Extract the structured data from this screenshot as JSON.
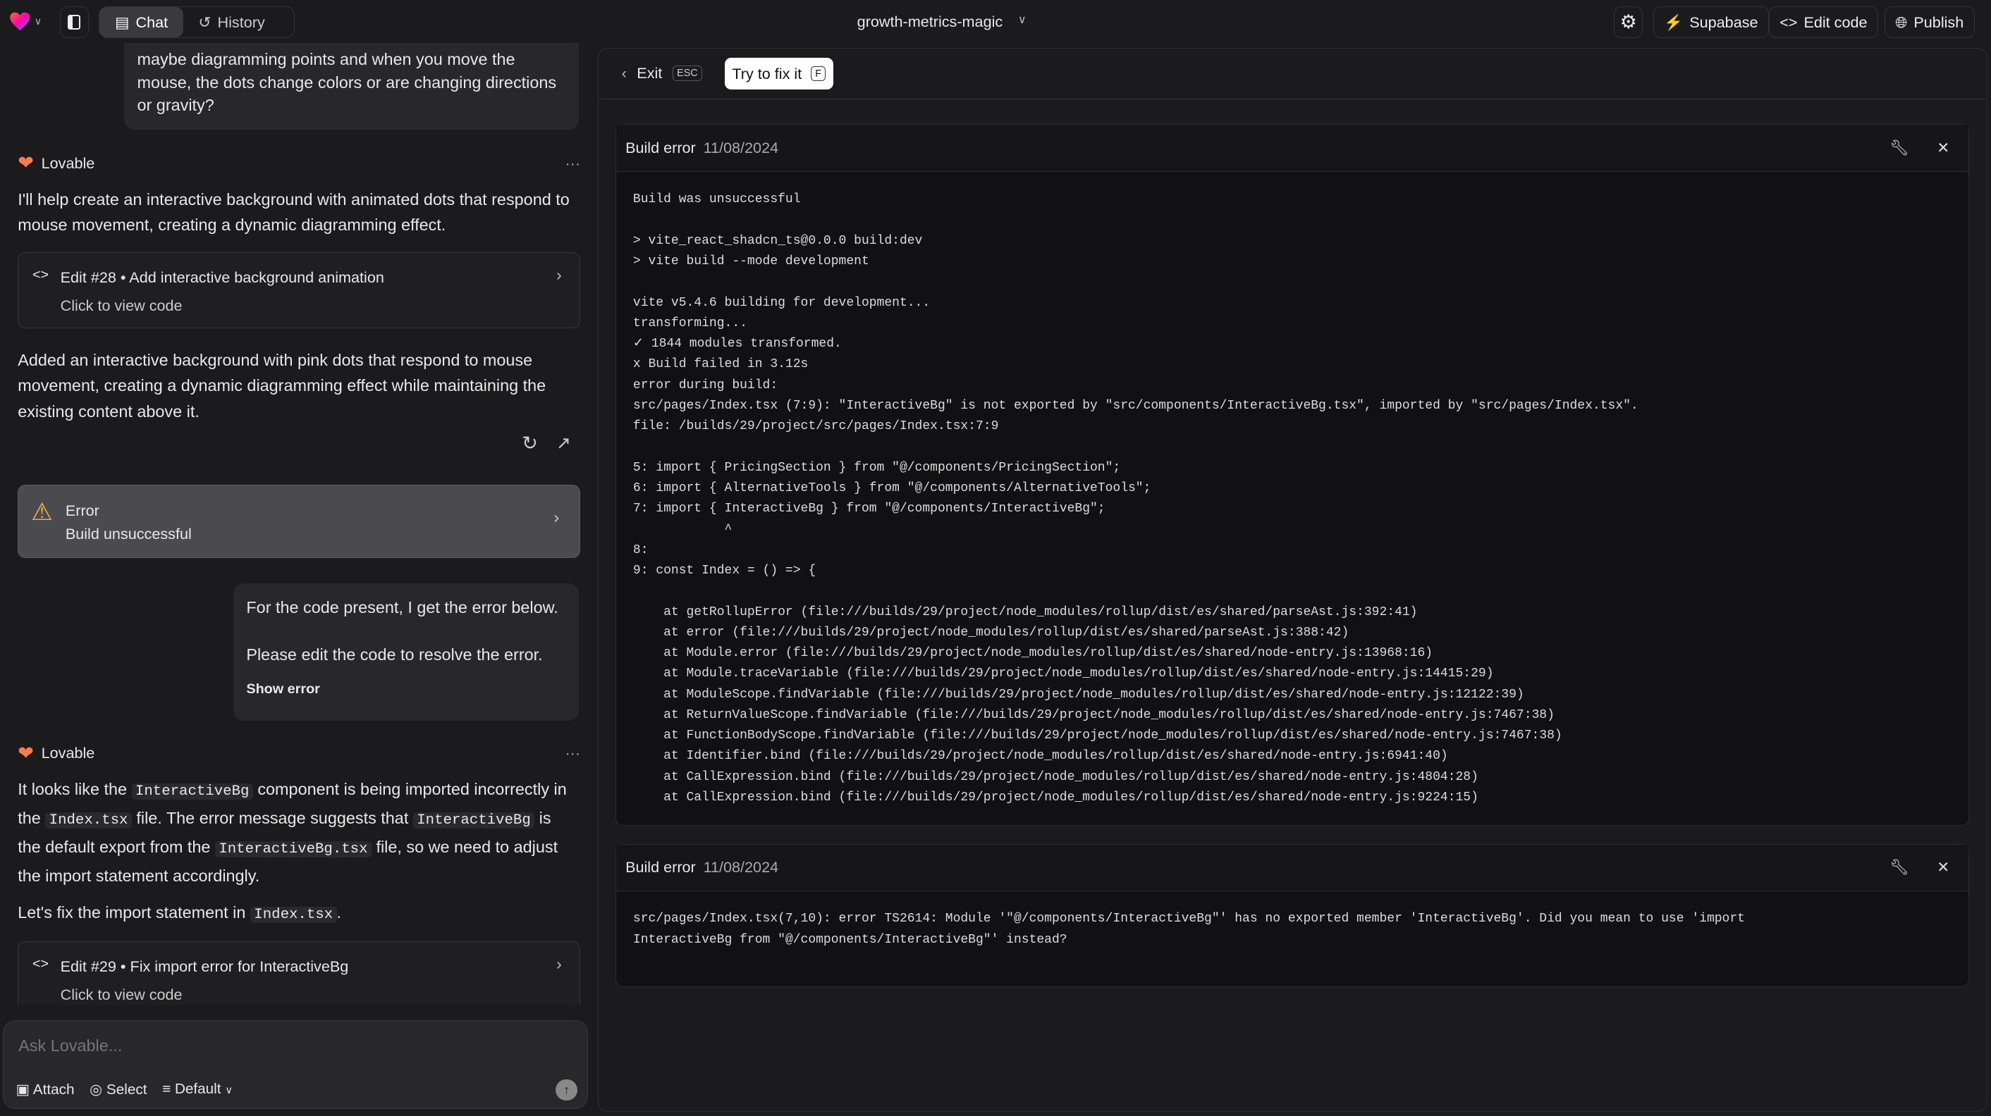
{
  "topbar": {
    "tabs": [
      {
        "label": "Chat",
        "icon": "chat-icon"
      },
      {
        "label": "History",
        "icon": "history-icon"
      }
    ],
    "project": "growth-metrics-magic",
    "buttons": {
      "supabase": "Supabase",
      "edit_code": "Edit code",
      "publish": "Publish"
    },
    "colors": {
      "supabase": "#3ecf8e"
    }
  },
  "chat": {
    "user_msg_1": "maybe diagramming points and when you move the mouse, the dots change colors or are changing directions or gravity?",
    "assistant_name": "Lovable",
    "reply_1": "I'll help create an interactive background with animated dots that respond to mouse movement, creating a dynamic diagramming effect.",
    "edit_28": {
      "title": "Edit #28 • Add interactive background animation",
      "sub": "Click to view code"
    },
    "reply_2": "Added an interactive background with pink dots that respond to mouse movement, creating a dynamic diagramming effect while maintaining the existing content above it.",
    "error_card": {
      "title": "Error",
      "sub": "Build unsuccessful"
    },
    "user_msg_2": {
      "line1": "For the code present, I get the error below.",
      "line2": "Please edit the code to resolve the error.",
      "link": "Show error"
    },
    "reply_3": {
      "a": "It looks like the ",
      "b": "InteractiveBg",
      "c": " component is being imported incorrectly in the ",
      "d": "Index.tsx",
      "e": " file. The error message suggests that ",
      "f": "InteractiveBg",
      "g": " is the default export from the ",
      "h": "InteractiveBg.tsx",
      "i": " file, so we need to adjust the import statement accordingly."
    },
    "reply_4": {
      "a": "Let's fix the import statement in ",
      "b": "Index.tsx",
      "c": "."
    },
    "edit_29": {
      "title": "Edit #29 • Fix import error for InteractiveBg",
      "sub": "Click to view code"
    },
    "input": {
      "placeholder": "Ask Lovable...",
      "attach": "Attach",
      "select": "Select",
      "mode": "Default"
    }
  },
  "panel": {
    "exit": "Exit",
    "exit_key": "ESC",
    "fix": "Try to fix it",
    "fix_key": "F",
    "errors": [
      {
        "title": "Build error",
        "date": "11/08/2024",
        "log": "Build was unsuccessful\n\n> vite_react_shadcn_ts@0.0.0 build:dev\n> vite build --mode development\n\nvite v5.4.6 building for development...\ntransforming...\n✓ 1844 modules transformed.\nx Build failed in 3.12s\nerror during build:\nsrc/pages/Index.tsx (7:9): \"InteractiveBg\" is not exported by \"src/components/InteractiveBg.tsx\", imported by \"src/pages/Index.tsx\".\nfile: /builds/29/project/src/pages/Index.tsx:7:9\n\n5: import { PricingSection } from \"@/components/PricingSection\";\n6: import { AlternativeTools } from \"@/components/AlternativeTools\";\n7: import { InteractiveBg } from \"@/components/InteractiveBg\";\n            ^\n8:\n9: const Index = () => {\n\n    at getRollupError (file:///builds/29/project/node_modules/rollup/dist/es/shared/parseAst.js:392:41)\n    at error (file:///builds/29/project/node_modules/rollup/dist/es/shared/parseAst.js:388:42)\n    at Module.error (file:///builds/29/project/node_modules/rollup/dist/es/shared/node-entry.js:13968:16)\n    at Module.traceVariable (file:///builds/29/project/node_modules/rollup/dist/es/shared/node-entry.js:14415:29)\n    at ModuleScope.findVariable (file:///builds/29/project/node_modules/rollup/dist/es/shared/node-entry.js:12122:39)\n    at ReturnValueScope.findVariable (file:///builds/29/project/node_modules/rollup/dist/es/shared/node-entry.js:7467:38)\n    at FunctionBodyScope.findVariable (file:///builds/29/project/node_modules/rollup/dist/es/shared/node-entry.js:7467:38)\n    at Identifier.bind (file:///builds/29/project/node_modules/rollup/dist/es/shared/node-entry.js:6941:40)\n    at CallExpression.bind (file:///builds/29/project/node_modules/rollup/dist/es/shared/node-entry.js:4804:28)\n    at CallExpression.bind (file:///builds/29/project/node_modules/rollup/dist/es/shared/node-entry.js:9224:15)"
      },
      {
        "title": "Build error",
        "date": "11/08/2024",
        "log": "src/pages/Index.tsx(7,10): error TS2614: Module '\"@/components/InteractiveBg\"' has no exported member 'InteractiveBg'. Did you mean to use 'import\nInteractiveBg from \"@/components/InteractiveBg\"' instead?"
      }
    ]
  }
}
